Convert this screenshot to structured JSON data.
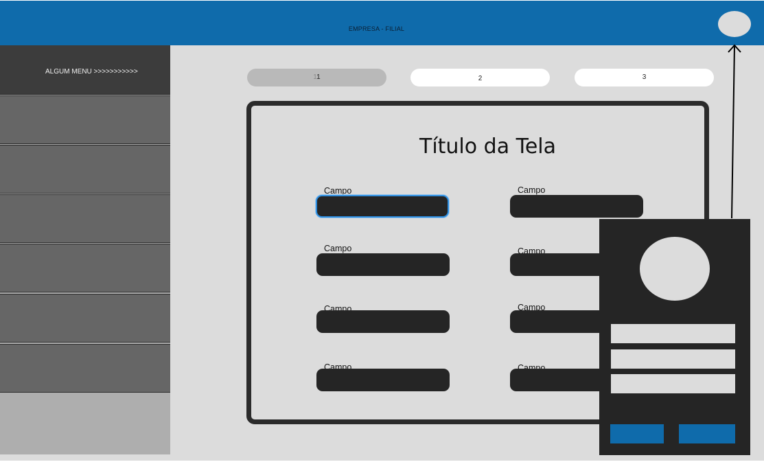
{
  "header": {
    "title": "EMPRESA - FILIAL"
  },
  "sidebar": {
    "menu_title": "ALGUM MENU >>>>>>>>>>>"
  },
  "steps": [
    {
      "prefix": "1",
      "label": "1"
    },
    {
      "label": "2"
    },
    {
      "label": "3"
    }
  ],
  "form": {
    "title": "Título da Tela",
    "fields": [
      {
        "label": "Campo",
        "value": ""
      },
      {
        "label": "Campo",
        "value": ""
      },
      {
        "label": "Campo",
        "value": ""
      },
      {
        "label": "Campo",
        "value": ""
      },
      {
        "label": "Campo",
        "value": ""
      },
      {
        "label": "Campo",
        "value": ""
      },
      {
        "label": "Campo",
        "value": ""
      },
      {
        "label": "Campo",
        "value": ""
      }
    ]
  },
  "colors": {
    "brand": "#0f6bab",
    "surface": "#dcdcdc",
    "dark": "#252525",
    "focus": "#2e8ee0"
  }
}
